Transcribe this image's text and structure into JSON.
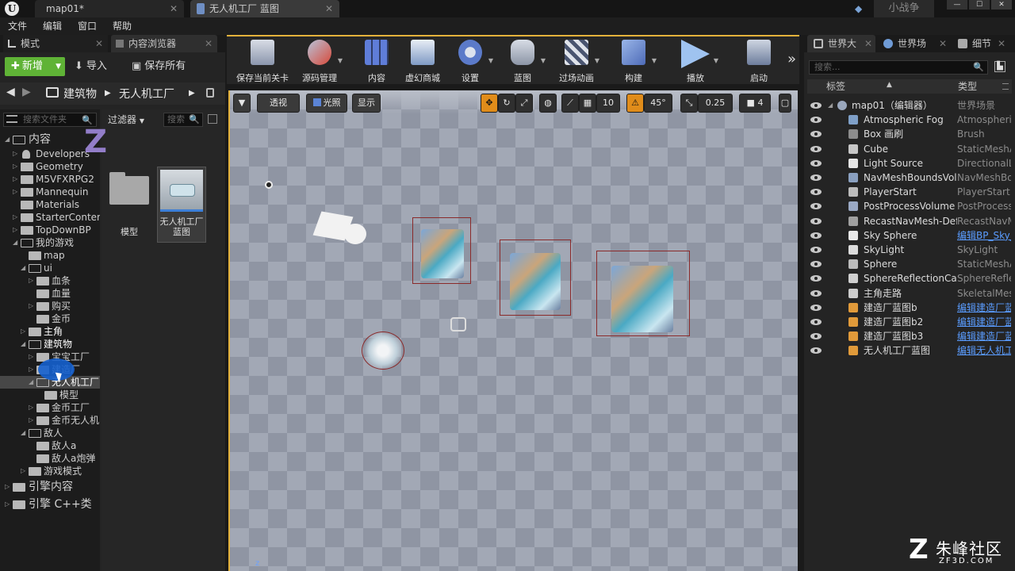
{
  "titlebar": {
    "tab1": "map01*",
    "tab2": "无人机工厂 蓝图",
    "project": "小战争",
    "min": "—",
    "max": "☐",
    "close": "✕"
  },
  "menu": [
    "文件",
    "编辑",
    "窗口",
    "帮助"
  ],
  "left_tabs": {
    "modes": "模式",
    "content_browser": "内容浏览器"
  },
  "content_toolbar": {
    "new": "新增",
    "import": "导入",
    "save_all": "保存所有"
  },
  "path": {
    "seg1": "建筑物",
    "seg2": "无人机工厂"
  },
  "tree": {
    "search_placeholder": "搜索文件夹",
    "items": [
      "内容",
      "Developers",
      "Geometry",
      "M5VFXRPG2",
      "Mannequin",
      "Materials",
      "StarterContent",
      "TopDownBP",
      "我的游戏",
      "map",
      "ui",
      "血条",
      "血量",
      "购买",
      "金币",
      "主角",
      "建筑物",
      "宝宝工厂",
      "建造厂",
      "无人机工厂",
      "模型",
      "金币工厂",
      "金币无人机",
      "敌人",
      "敌人a",
      "敌人a炮弹",
      "游戏模式",
      "引擎内容",
      "引擎 C++类"
    ]
  },
  "assets": {
    "filter": "过滤器",
    "search_placeholder": "搜索",
    "folder_label": "模型",
    "bp_label": "无人机工厂蓝图"
  },
  "toolbar": {
    "save_level": "保存当前关卡",
    "source_control": "源码管理",
    "content": "内容",
    "marketplace": "虚幻商城",
    "settings": "设置",
    "blueprints": "蓝图",
    "cinematics": "过场动画",
    "build": "构建",
    "play": "播放",
    "launch": "启动"
  },
  "viewport": {
    "perspective": "透视",
    "lit": "光照",
    "show": "显示",
    "grid": "10",
    "angle": "45°",
    "scale": "0.25",
    "camera": "4",
    "axis": "z"
  },
  "right_tabs": {
    "outliner": "世界大",
    "world": "世界场",
    "details": "细节"
  },
  "outliner": {
    "search_placeholder": "搜索...",
    "col_label": "标签",
    "col_type": "类型",
    "rows": [
      {
        "name": "map01（编辑器）",
        "type": "世界场景",
        "link": false
      },
      {
        "name": "Atmospheric Fog",
        "type": "AtmosphericFog",
        "link": false
      },
      {
        "name": "Box 画刷",
        "type": "Brush",
        "link": false
      },
      {
        "name": "Cube",
        "type": "StaticMeshActor",
        "link": false
      },
      {
        "name": "Light Source",
        "type": "DirectionalLight",
        "link": false
      },
      {
        "name": "NavMeshBoundsVolume",
        "type": "NavMeshBoundsVolume",
        "link": false
      },
      {
        "name": "PlayerStart",
        "type": "PlayerStart",
        "link": false
      },
      {
        "name": "PostProcessVolume",
        "type": "PostProcessVolume",
        "link": false
      },
      {
        "name": "RecastNavMesh-Default",
        "type": "RecastNavMesh",
        "link": false
      },
      {
        "name": "Sky Sphere",
        "type": "编辑BP_Sky_Sphere",
        "link": true
      },
      {
        "name": "SkyLight",
        "type": "SkyLight",
        "link": false
      },
      {
        "name": "Sphere",
        "type": "StaticMeshActor",
        "link": false
      },
      {
        "name": "SphereReflectionCapture",
        "type": "SphereReflectionCapture",
        "link": false
      },
      {
        "name": "主角走路",
        "type": "SkeletalMeshActor",
        "link": false
      },
      {
        "name": "建造厂蓝图b",
        "type": "编辑建造厂蓝图b",
        "link": true
      },
      {
        "name": "建造厂蓝图b2",
        "type": "编辑建造厂蓝图b",
        "link": true
      },
      {
        "name": "建造厂蓝图b3",
        "type": "编辑建造厂蓝图b",
        "link": true
      },
      {
        "name": "无人机工厂蓝图",
        "type": "编辑无人机工厂蓝图",
        "link": true
      }
    ]
  },
  "watermark": {
    "title": "朱峰社区",
    "url": "ZF3D.COM"
  },
  "colors": {
    "accent": "#e4b23b",
    "new_button": "#5fb336",
    "link": "#5a9cff",
    "selection": "#1560ce"
  }
}
